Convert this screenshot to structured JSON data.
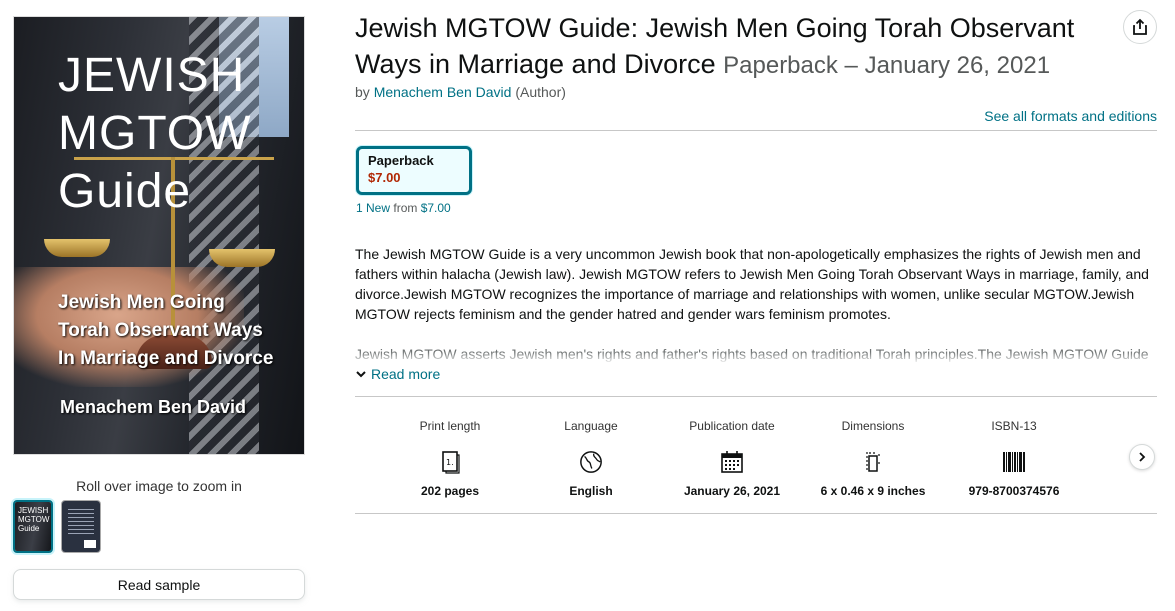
{
  "cover": {
    "title_big": "JEWISH\nMGTOW\nGuide",
    "subtitle": "Jewish Men Going\nTorah Observant Ways\nIn Marriage and Divorce",
    "author": "Menachem Ben David"
  },
  "gallery": {
    "zoom_hint": "Roll over image to zoom in",
    "thumb_front_text": "JEWISH\nMGTOW\nGuide",
    "read_sample": "Read sample"
  },
  "product": {
    "title": "Jewish MGTOW Guide: Jewish Men Going Torah Observant Ways in Marriage and Divorce",
    "edition": "Paperback – January 26, 2021",
    "by": "by",
    "author": "Menachem Ben David",
    "author_role": "(Author)",
    "see_formats": "See all formats and editions"
  },
  "format": {
    "name": "Paperback",
    "price": "$7.00",
    "offers_link": "1 New",
    "offers_from": "from",
    "offers_price": "$7.00"
  },
  "description": {
    "para1": "The Jewish MGTOW Guide is a very uncommon Jewish book that non-apologetically emphasizes the rights of Jewish men and fathers within halacha (Jewish law). Jewish MGTOW refers to Jewish Men Going Torah Observant Ways in marriage, family, and divorce.Jewish MGTOW recognizes the importance of marriage and relationships with women, unlike secular MGTOW.Jewish MGTOW rejects feminism and the gender hatred and gender wars feminism promotes.",
    "para2": "Jewish MGTOW asserts Jewish men's rights and father's rights based on traditional Torah principles.The Jewish MGTOW Guide",
    "read_more": "Read more"
  },
  "details": [
    {
      "label": "Print length",
      "value": "202 pages",
      "icon": "pages-icon"
    },
    {
      "label": "Language",
      "value": "English",
      "icon": "globe-icon"
    },
    {
      "label": "Publication date",
      "value": "January 26, 2021",
      "icon": "calendar-icon"
    },
    {
      "label": "Dimensions",
      "value": "6 x 0.46 x 9 inches",
      "icon": "dimensions-icon"
    },
    {
      "label": "ISBN-13",
      "value": "979-8700374576",
      "icon": "barcode-icon"
    }
  ],
  "colors": {
    "link": "#007185",
    "price": "#b12704",
    "selected_border": "#007185"
  }
}
